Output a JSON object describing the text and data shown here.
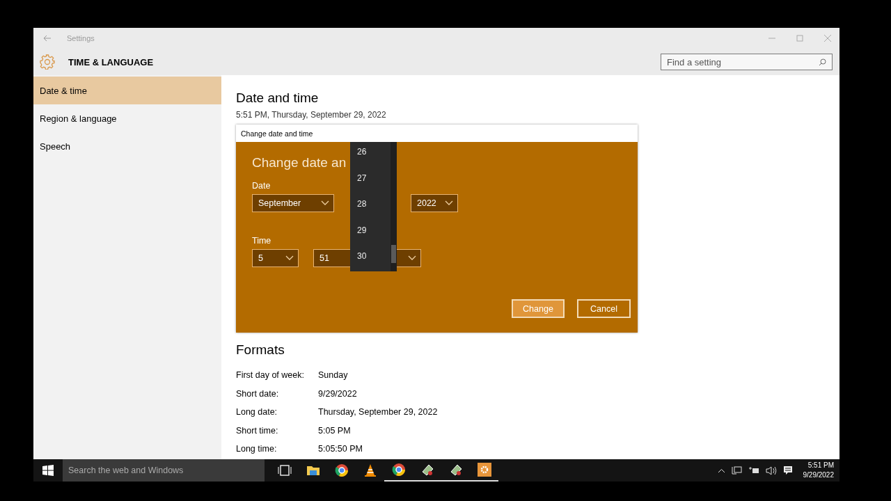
{
  "window": {
    "title": "Settings"
  },
  "header": {
    "title": "TIME & LANGUAGE",
    "search": {
      "placeholder": "Find a setting"
    }
  },
  "sidebar": {
    "items": [
      {
        "label": "Date & time",
        "selected": true
      },
      {
        "label": "Region & language",
        "selected": false
      },
      {
        "label": "Speech",
        "selected": false
      }
    ]
  },
  "content": {
    "heading": "Date and time",
    "current_datetime": "5:51 PM, Thursday, September 29, 2022",
    "formats": {
      "heading": "Formats",
      "rows": [
        {
          "label": "First day of week:",
          "value": "Sunday"
        },
        {
          "label": "Short date:",
          "value": "9/29/2022"
        },
        {
          "label": "Long date:",
          "value": "Thursday, September 29, 2022"
        },
        {
          "label": "Short time:",
          "value": "5:05 PM"
        },
        {
          "label": "Long time:",
          "value": "5:05:50 PM"
        }
      ]
    }
  },
  "dialog": {
    "title": "Change date and time",
    "heading": "Change date an",
    "date_label": "Date",
    "month": "September",
    "year": "2022",
    "time_label": "Time",
    "hour": "5",
    "minute": "51",
    "day_list": [
      "26",
      "27",
      "28",
      "29",
      "30"
    ],
    "buttons": [
      {
        "label": "Change",
        "kind": "primary"
      },
      {
        "label": "Cancel",
        "kind": "secondary"
      }
    ]
  },
  "taskbar": {
    "search": {
      "placeholder": "Search the web and Windows"
    },
    "apps": [
      {
        "kind": "taskview",
        "running": false
      },
      {
        "kind": "folder",
        "running": false
      },
      {
        "kind": "browser",
        "running": false
      },
      {
        "kind": "cone",
        "running": false
      },
      {
        "kind": "browser",
        "running": true
      },
      {
        "kind": "tool",
        "running": true
      },
      {
        "kind": "tool",
        "running": true
      },
      {
        "kind": "gear",
        "running": true
      }
    ],
    "clock": {
      "time": "5:51 PM",
      "date": "9/29/2022"
    }
  }
}
